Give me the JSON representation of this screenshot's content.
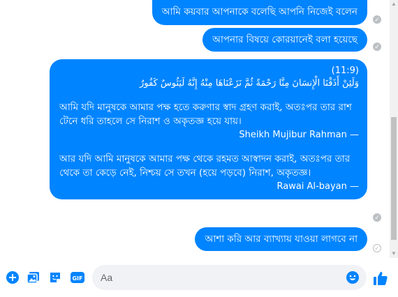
{
  "messages": [
    {
      "text": "আমি কয়বার আপনাকে বলেছি আপনি নিজেই বলেন"
    },
    {
      "text": "আপনার বিষয়ে কোরয়ানেই বলা হয়েছে"
    },
    {
      "ref": "(11:9)",
      "arabic": "وَلَئِنْ أَذَقْنَا الْإِنسَانَ مِنَّا رَحْمَةً ثُمَّ نَزَعْنَاهَا مِنْهُ إِنَّهُ لَيَئُوسٌ كَفُورٌ",
      "translation1": "আমি যদি মানুষকে আমার পক্ষ হতে করুণার স্বাদ গ্রহণ করাই, অতঃপর তার রাশ টেনে ধরি তাহলে সে নিরাশ ও অকৃতজ্ঞ হয়ে যায়।",
      "author1": "Sheikh Mujibur Rahman —",
      "translation2": "আর যদি আমি মানুষকে আমার পক্ষ থেকে রহমত আস্বাদন করাই, অতঃপর তার থেকে তা কেড়ে নেই, নিশ্চয় সে তখন (হয়ে পড়বে) নিরাশ, অকৃতজ্ঞ।",
      "author2": "Rawai Al-bayan —"
    },
    {
      "text": "আশা করি আর ব্যাখ্যায় যাওয়া লাগবে না"
    }
  ],
  "composer": {
    "placeholder": "Aa"
  },
  "colors": {
    "bubble": "#0084ff",
    "accent": "#0084ff",
    "input_bg": "#f0f2f5"
  },
  "icons": [
    "plus-circle-icon",
    "image-icon",
    "sticker-icon",
    "gif-icon",
    "emoji-icon",
    "thumbs-up-icon",
    "seen-check-icon"
  ]
}
